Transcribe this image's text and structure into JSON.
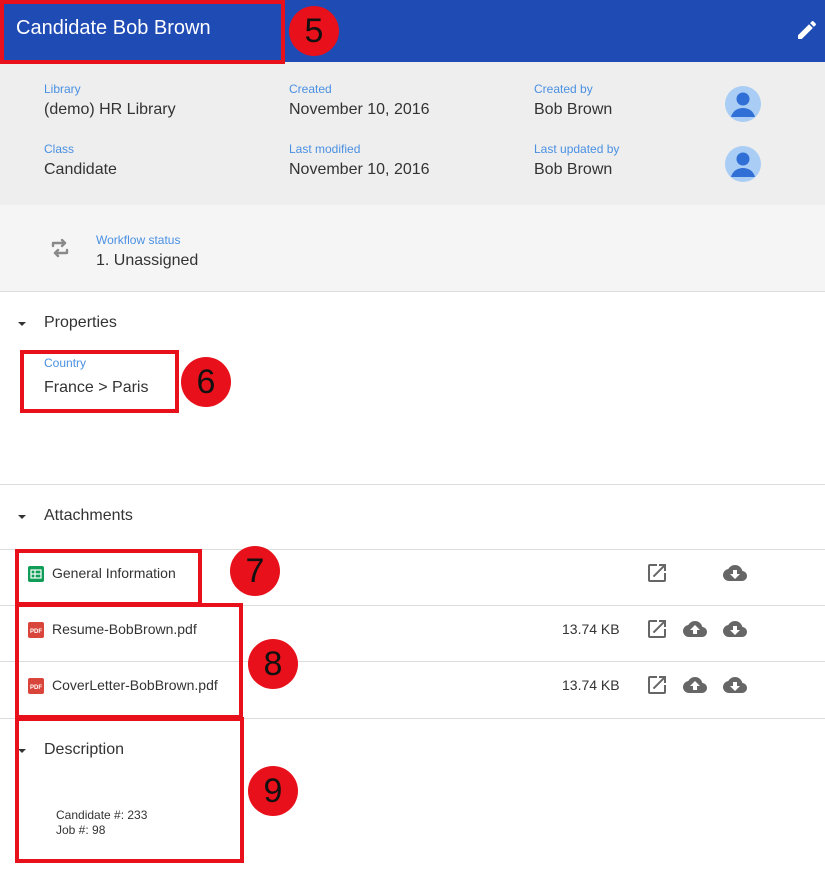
{
  "header": {
    "title": "Candidate Bob Brown"
  },
  "meta": {
    "library": {
      "label": "Library",
      "value": "(demo) HR Library"
    },
    "class": {
      "label": "Class",
      "value": "Candidate"
    },
    "created": {
      "label": "Created",
      "value": "November 10, 2016"
    },
    "last_modified": {
      "label": "Last modified",
      "value": "November 10, 2016"
    },
    "created_by": {
      "label": "Created by",
      "value": "Bob Brown"
    },
    "last_updated_by": {
      "label": "Last updated by",
      "value": "Bob Brown"
    }
  },
  "workflow": {
    "label": "Workflow status",
    "value": "1. Unassigned"
  },
  "properties": {
    "title": "Properties",
    "country": {
      "label": "Country",
      "value": "France > Paris"
    }
  },
  "attachments": {
    "title": "Attachments",
    "items": [
      {
        "name": "General Information",
        "size": "",
        "icon": "sheet-icon"
      },
      {
        "name": "Resume-BobBrown.pdf",
        "size": "13.74 KB",
        "icon": "pdf-icon"
      },
      {
        "name": "CoverLetter-BobBrown.pdf",
        "size": "13.74 KB",
        "icon": "pdf-icon"
      }
    ]
  },
  "description": {
    "title": "Description",
    "lines": [
      "Candidate #: 233",
      "Job #: 98"
    ]
  },
  "callouts": [
    "5",
    "6",
    "7",
    "8",
    "9"
  ],
  "colors": {
    "header": "#1f4bb4",
    "accent_label": "#4a90e2",
    "annotation": "#e8101a"
  },
  "icons": {
    "edit": "pencil-icon",
    "avatar": "user-avatar-icon",
    "workflow": "sync-icon",
    "caret": "caret-down-icon",
    "open": "open-in-new-icon",
    "upload": "cloud-upload-icon",
    "download": "cloud-download-icon",
    "pdf_badge": "PDF"
  }
}
